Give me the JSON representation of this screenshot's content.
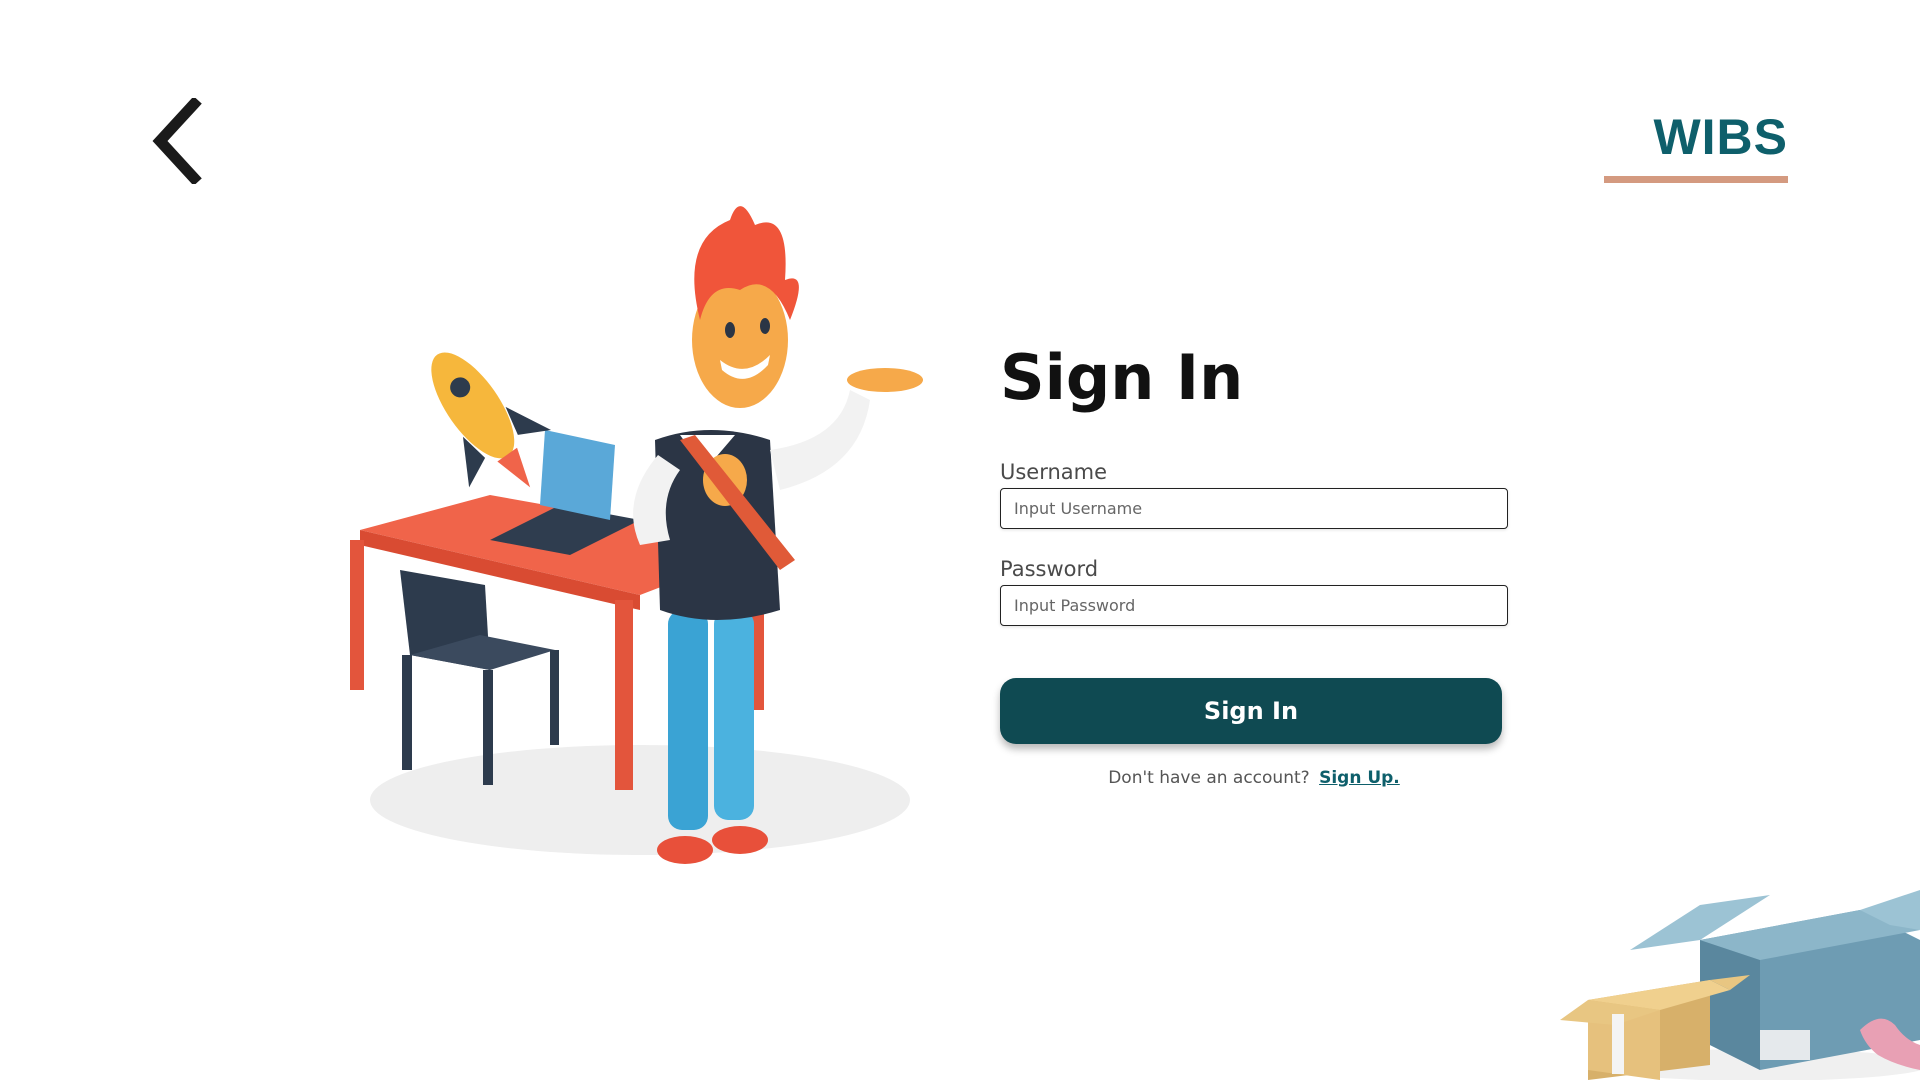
{
  "back": {
    "icon": "chevron-left-icon"
  },
  "logo": {
    "text": "WIBS",
    "color": "#0e5f6b",
    "underline_color": "#d49a80"
  },
  "illustration": {
    "description_icon": "person-desk-rocket-illustration"
  },
  "form": {
    "title": "Sign In",
    "username": {
      "label": "Username",
      "placeholder": "Input Username",
      "value": ""
    },
    "password": {
      "label": "Password",
      "placeholder": "Input Password",
      "value": ""
    },
    "submit_label": "Sign In",
    "submit_color": "#0f4a52",
    "signup_prompt": "Don't have an account?",
    "signup_link": "Sign Up.",
    "link_color": "#0e5f6b"
  },
  "decoration": {
    "icon": "open-boxes-illustration"
  }
}
